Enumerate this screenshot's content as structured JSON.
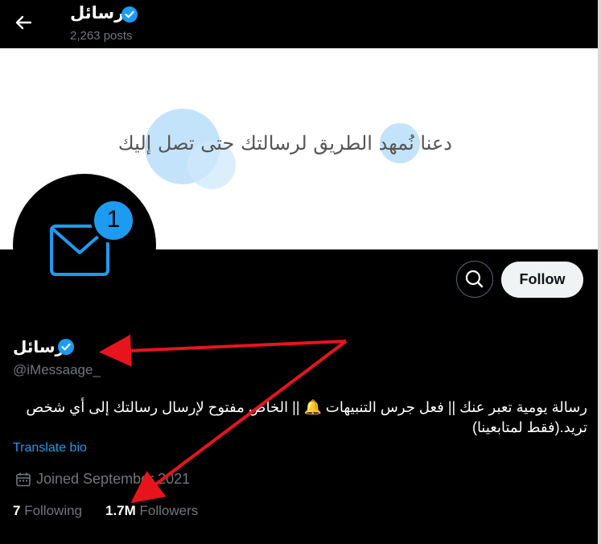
{
  "header": {
    "title": "رسائل",
    "posts": "2,263 posts"
  },
  "banner": {
    "text": "دعنا نُمهد الطريق لرسالتك حتى تصل إليك"
  },
  "avatar": {
    "badge": "1"
  },
  "actions": {
    "follow_label": "Follow"
  },
  "profile": {
    "name": "رسائل",
    "handle": "@iMessaage_",
    "bio": "رسالة يومية تعبر عنك || فعل جرس التنبيهات 🔔 || الخاص مفتوح لإرسال رسالتك إلى أي شخص تريد.(فقط لمتابعينا)",
    "translate": "Translate bio",
    "joined": "Joined September 2021",
    "following_count": "7",
    "following_label": " Following",
    "followers_count": "1.7M",
    "followers_label": " Followers"
  },
  "colors": {
    "accent": "#1d9bf0",
    "annotation": "#e8141c"
  }
}
